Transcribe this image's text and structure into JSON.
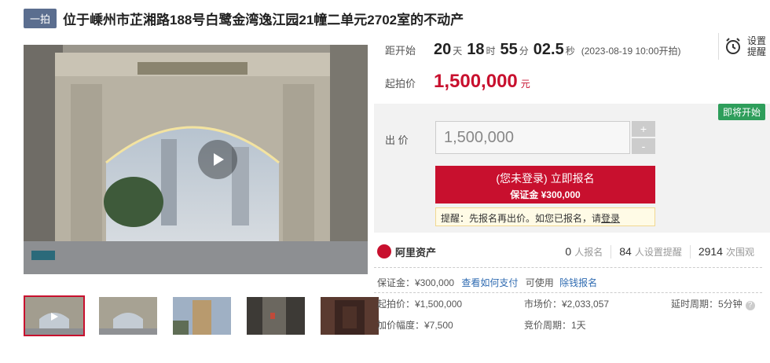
{
  "title": {
    "tag": "一拍",
    "text": "位于嵊州市芷湘路188号白鹭金湾逸江园21幢二单元2702室的不动产"
  },
  "countdown": {
    "label": "距开始",
    "days": "20",
    "days_unit": "天",
    "hours": "18",
    "hours_unit": "时",
    "minutes": "55",
    "minutes_unit": "分",
    "seconds": "02.5",
    "seconds_unit": "秒",
    "start_note": "(2023-08-19 10:00开拍)"
  },
  "reminder": {
    "label": "设置提醒",
    "icon": "alarm-clock-icon"
  },
  "start_price": {
    "label": "起拍价",
    "value": "1,500,000",
    "unit": "元"
  },
  "bid": {
    "badge": "即将开始",
    "label": "出 价",
    "input_value": "1,500,000",
    "plus": "+",
    "minus": "-",
    "signup_line1": "(您未登录) 立即报名",
    "signup_line2": "保证金 ¥300,000",
    "tip_prefix": "提醒：先报名再出价。如您已报名，请",
    "tip_link": "登录"
  },
  "platform": {
    "name": "阿里资产",
    "icon": "ali-assets-logo-icon"
  },
  "stats": [
    {
      "num": "0",
      "label": "人报名"
    },
    {
      "num": "84",
      "label": "人设置提醒"
    },
    {
      "num": "2914",
      "label": "次围观"
    }
  ],
  "deposit_line": {
    "deposit": "保证金：¥300,000",
    "how_to_pay": "查看如何支付",
    "usable": "可使用",
    "exempt": "除钱报名"
  },
  "details": {
    "start_price": "起拍价：¥1,500,000",
    "market_price": "市场价：¥2,033,057",
    "delay_period": "延时周期：5分钟",
    "increment": "加价幅度：¥7,500",
    "bid_cycle": "竞价周期：1天"
  },
  "colors": {
    "accent": "#c8102e",
    "tag": "#5b6e8f",
    "link": "#2f6bb1",
    "badge": "#2e9e5b"
  }
}
